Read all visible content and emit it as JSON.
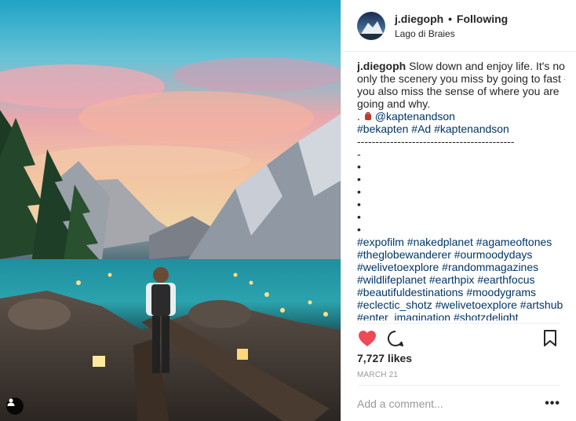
{
  "post": {
    "username": "j.diegoph",
    "separator": "•",
    "follow_label": "Following",
    "location": "Lago di Braies",
    "photo_alt": "Man standing on a log at Lago di Braies",
    "user_tag_icon": "person-icon"
  },
  "caption": {
    "username": "j.diegoph",
    "text": "Slow down and enjoy life. It's not",
    "lines": [
      "only the scenery you miss by going to fast -",
      "you also miss the sense of where you are",
      "going and why."
    ],
    "mention_prefix": ".",
    "mention": "@kaptenandson",
    "tags_line1": "#bekapten #Ad #kaptenandson",
    "divider": "-------------------------------------------",
    "dash": "-",
    "bullets": [
      "•",
      "•",
      "•",
      "•",
      "•",
      "•"
    ],
    "hashtags": [
      "#expofilm #nakedplanet #agameoftones",
      "#theglobewanderer #ourmoodydays",
      "#welivetoexplore #randommagazines",
      "#wildlifeplanet #earthpix #earthfocus",
      "#beautifuldestinations #moodygrams",
      "#eclectic_shotz #welivetoexplore #artshub",
      "#enter_imagination #shotzdelight"
    ]
  },
  "actions": {
    "like_icon": "heart-filled-icon",
    "comment_icon": "comment-icon",
    "save_icon": "bookmark-icon",
    "like_color": "#ed4956"
  },
  "stats": {
    "likes": "7,727 likes",
    "date": "MARCH 21"
  },
  "comment": {
    "placeholder": "Add a comment...",
    "more_label": "•••"
  }
}
